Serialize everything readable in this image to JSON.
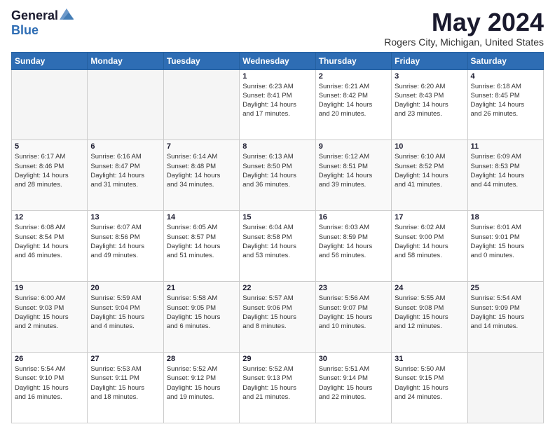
{
  "logo": {
    "general": "General",
    "blue": "Blue"
  },
  "title": "May 2024",
  "location": "Rogers City, Michigan, United States",
  "days_of_week": [
    "Sunday",
    "Monday",
    "Tuesday",
    "Wednesday",
    "Thursday",
    "Friday",
    "Saturday"
  ],
  "weeks": [
    [
      {
        "day": "",
        "info": ""
      },
      {
        "day": "",
        "info": ""
      },
      {
        "day": "",
        "info": ""
      },
      {
        "day": "1",
        "info": "Sunrise: 6:23 AM\nSunset: 8:41 PM\nDaylight: 14 hours\nand 17 minutes."
      },
      {
        "day": "2",
        "info": "Sunrise: 6:21 AM\nSunset: 8:42 PM\nDaylight: 14 hours\nand 20 minutes."
      },
      {
        "day": "3",
        "info": "Sunrise: 6:20 AM\nSunset: 8:43 PM\nDaylight: 14 hours\nand 23 minutes."
      },
      {
        "day": "4",
        "info": "Sunrise: 6:18 AM\nSunset: 8:45 PM\nDaylight: 14 hours\nand 26 minutes."
      }
    ],
    [
      {
        "day": "5",
        "info": "Sunrise: 6:17 AM\nSunset: 8:46 PM\nDaylight: 14 hours\nand 28 minutes."
      },
      {
        "day": "6",
        "info": "Sunrise: 6:16 AM\nSunset: 8:47 PM\nDaylight: 14 hours\nand 31 minutes."
      },
      {
        "day": "7",
        "info": "Sunrise: 6:14 AM\nSunset: 8:48 PM\nDaylight: 14 hours\nand 34 minutes."
      },
      {
        "day": "8",
        "info": "Sunrise: 6:13 AM\nSunset: 8:50 PM\nDaylight: 14 hours\nand 36 minutes."
      },
      {
        "day": "9",
        "info": "Sunrise: 6:12 AM\nSunset: 8:51 PM\nDaylight: 14 hours\nand 39 minutes."
      },
      {
        "day": "10",
        "info": "Sunrise: 6:10 AM\nSunset: 8:52 PM\nDaylight: 14 hours\nand 41 minutes."
      },
      {
        "day": "11",
        "info": "Sunrise: 6:09 AM\nSunset: 8:53 PM\nDaylight: 14 hours\nand 44 minutes."
      }
    ],
    [
      {
        "day": "12",
        "info": "Sunrise: 6:08 AM\nSunset: 8:54 PM\nDaylight: 14 hours\nand 46 minutes."
      },
      {
        "day": "13",
        "info": "Sunrise: 6:07 AM\nSunset: 8:56 PM\nDaylight: 14 hours\nand 49 minutes."
      },
      {
        "day": "14",
        "info": "Sunrise: 6:05 AM\nSunset: 8:57 PM\nDaylight: 14 hours\nand 51 minutes."
      },
      {
        "day": "15",
        "info": "Sunrise: 6:04 AM\nSunset: 8:58 PM\nDaylight: 14 hours\nand 53 minutes."
      },
      {
        "day": "16",
        "info": "Sunrise: 6:03 AM\nSunset: 8:59 PM\nDaylight: 14 hours\nand 56 minutes."
      },
      {
        "day": "17",
        "info": "Sunrise: 6:02 AM\nSunset: 9:00 PM\nDaylight: 14 hours\nand 58 minutes."
      },
      {
        "day": "18",
        "info": "Sunrise: 6:01 AM\nSunset: 9:01 PM\nDaylight: 15 hours\nand 0 minutes."
      }
    ],
    [
      {
        "day": "19",
        "info": "Sunrise: 6:00 AM\nSunset: 9:03 PM\nDaylight: 15 hours\nand 2 minutes."
      },
      {
        "day": "20",
        "info": "Sunrise: 5:59 AM\nSunset: 9:04 PM\nDaylight: 15 hours\nand 4 minutes."
      },
      {
        "day": "21",
        "info": "Sunrise: 5:58 AM\nSunset: 9:05 PM\nDaylight: 15 hours\nand 6 minutes."
      },
      {
        "day": "22",
        "info": "Sunrise: 5:57 AM\nSunset: 9:06 PM\nDaylight: 15 hours\nand 8 minutes."
      },
      {
        "day": "23",
        "info": "Sunrise: 5:56 AM\nSunset: 9:07 PM\nDaylight: 15 hours\nand 10 minutes."
      },
      {
        "day": "24",
        "info": "Sunrise: 5:55 AM\nSunset: 9:08 PM\nDaylight: 15 hours\nand 12 minutes."
      },
      {
        "day": "25",
        "info": "Sunrise: 5:54 AM\nSunset: 9:09 PM\nDaylight: 15 hours\nand 14 minutes."
      }
    ],
    [
      {
        "day": "26",
        "info": "Sunrise: 5:54 AM\nSunset: 9:10 PM\nDaylight: 15 hours\nand 16 minutes."
      },
      {
        "day": "27",
        "info": "Sunrise: 5:53 AM\nSunset: 9:11 PM\nDaylight: 15 hours\nand 18 minutes."
      },
      {
        "day": "28",
        "info": "Sunrise: 5:52 AM\nSunset: 9:12 PM\nDaylight: 15 hours\nand 19 minutes."
      },
      {
        "day": "29",
        "info": "Sunrise: 5:52 AM\nSunset: 9:13 PM\nDaylight: 15 hours\nand 21 minutes."
      },
      {
        "day": "30",
        "info": "Sunrise: 5:51 AM\nSunset: 9:14 PM\nDaylight: 15 hours\nand 22 minutes."
      },
      {
        "day": "31",
        "info": "Sunrise: 5:50 AM\nSunset: 9:15 PM\nDaylight: 15 hours\nand 24 minutes."
      },
      {
        "day": "",
        "info": ""
      }
    ]
  ]
}
